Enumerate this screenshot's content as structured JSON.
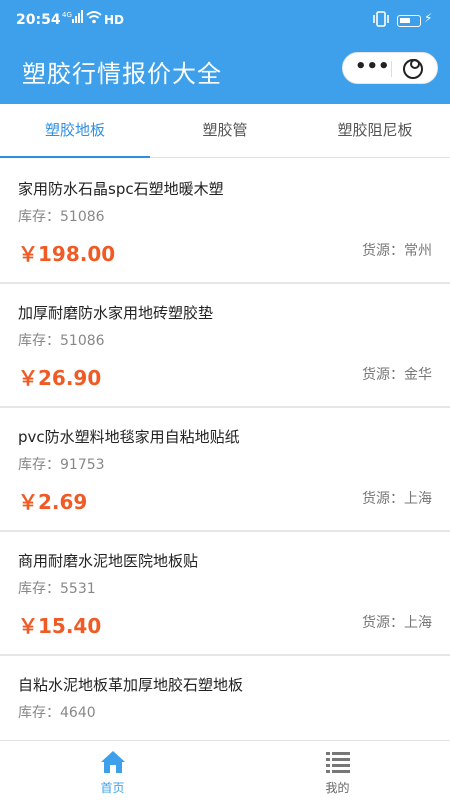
{
  "status_bar": {
    "time": "20:54",
    "network": "4G",
    "hd": "HD",
    "icons": [
      "signal-icon",
      "wifi-icon",
      "vibrate-icon",
      "battery-icon",
      "charging-icon"
    ]
  },
  "header": {
    "title": "塑胶行情报价大全",
    "more_icon": "ellipsis-icon",
    "close_icon": "close-icon",
    "bg_color": "#3ea0ea"
  },
  "tabs": [
    {
      "label": "塑胶地板",
      "active": true
    },
    {
      "label": "塑胶管",
      "active": false
    },
    {
      "label": "塑胶阻尼板",
      "active": false
    }
  ],
  "products": [
    {
      "title": "家用防水石晶spc石塑地暖木塑",
      "stock": "库存：51086",
      "price": "￥198.00",
      "origin": "货源：常州"
    },
    {
      "title": "加厚耐磨防水家用地砖塑胶垫",
      "stock": "库存：51086",
      "price": "￥26.90",
      "origin": "货源：金华"
    },
    {
      "title": "pvc防水塑料地毯家用自粘地贴纸",
      "stock": "库存：91753",
      "price": "￥2.69",
      "origin": "货源：上海"
    },
    {
      "title": "商用耐磨水泥地医院地板贴",
      "stock": "库存：5531",
      "price": "￥15.40",
      "origin": "货源：上海"
    },
    {
      "title": "自粘水泥地板革加厚地胶石塑地板",
      "stock": "库存：4640",
      "price": "",
      "origin": ""
    }
  ],
  "bottom_nav": {
    "home_label": "首页",
    "mine_label": "我的",
    "home_icon": "home-icon",
    "mine_icon": "list-icon"
  },
  "colors": {
    "accent": "#3ea0ea",
    "price": "#f05a24"
  }
}
